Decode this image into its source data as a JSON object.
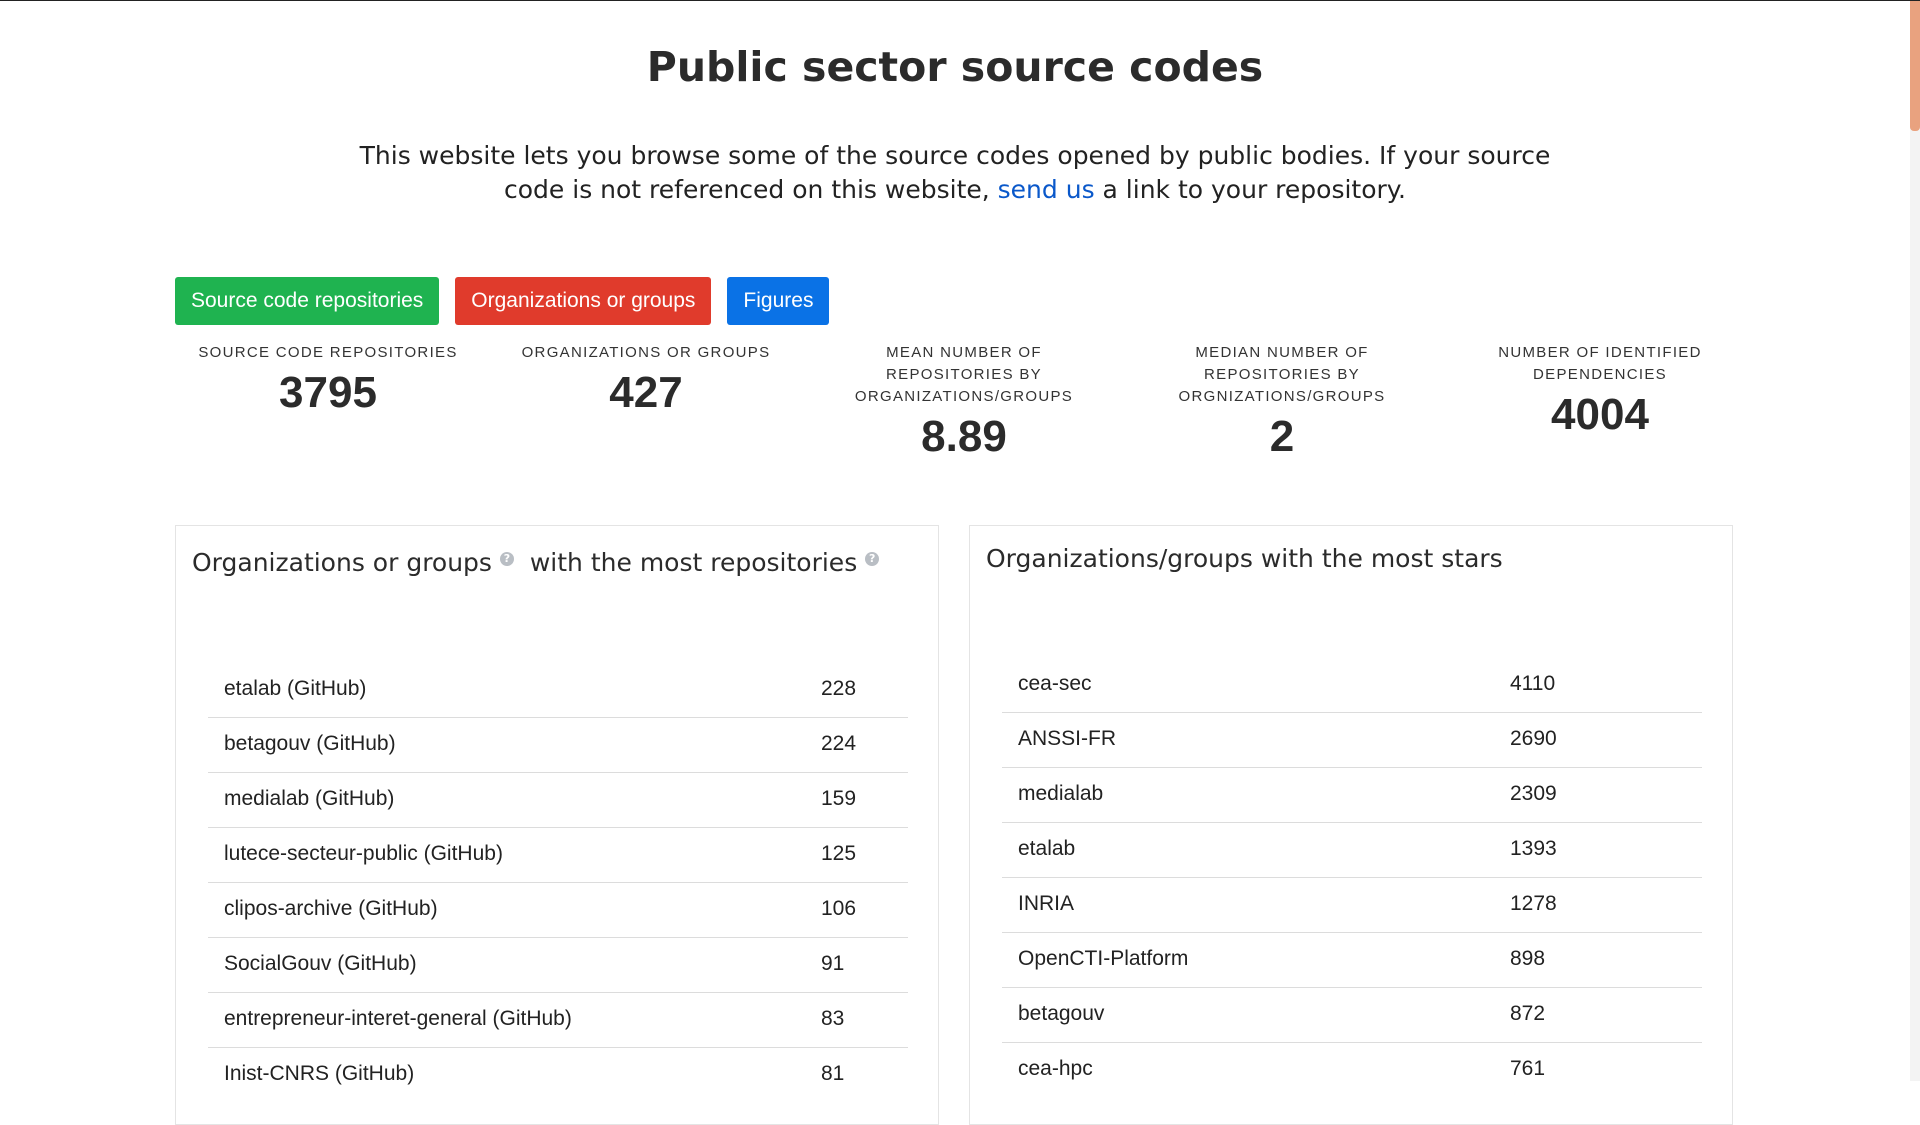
{
  "page": {
    "title": "Public sector source codes",
    "intro_before": "This website lets you browse some of the source codes opened by public bodies. If your source code is not referenced on this website, ",
    "intro_link": "send us",
    "intro_after": " a link to your repository."
  },
  "buttons": {
    "repos": "Source code repositories",
    "orgs": "Organizations or groups",
    "figures": "Figures"
  },
  "colors": {
    "green": "#1fb350",
    "red": "#e03b2c",
    "blue": "#0a72e6",
    "link": "#0a58ca"
  },
  "stats": [
    {
      "label": "SOURCE CODE REPOSITORIES",
      "value": "3795"
    },
    {
      "label": "ORGANIZATIONS OR GROUPS",
      "value": "427"
    },
    {
      "label": "MEAN NUMBER OF REPOSITORIES BY ORGANIZATIONS/GROUPS",
      "value": "8.89"
    },
    {
      "label": "MEDIAN NUMBER OF REPOSITORIES BY ORGNIZATIONS/GROUPS",
      "value": "2"
    },
    {
      "label": "NUMBER OF IDENTIFIED DEPENDENCIES",
      "value": "4004"
    }
  ],
  "panels": {
    "most_repos": {
      "title_part1": "Organizations or groups",
      "title_part2": "with the most repositories",
      "help_icon": "question-circle-icon",
      "rows": [
        {
          "name": "etalab (GitHub)",
          "count": "228"
        },
        {
          "name": "betagouv (GitHub)",
          "count": "224"
        },
        {
          "name": "medialab (GitHub)",
          "count": "159"
        },
        {
          "name": "lutece-secteur-public (GitHub)",
          "count": "125"
        },
        {
          "name": "clipos-archive (GitHub)",
          "count": "106"
        },
        {
          "name": "SocialGouv (GitHub)",
          "count": "91"
        },
        {
          "name": "entrepreneur-interet-general (GitHub)",
          "count": "83"
        },
        {
          "name": "Inist-CNRS (GitHub)",
          "count": "81"
        }
      ]
    },
    "most_stars": {
      "title": "Organizations/groups with the most stars",
      "rows": [
        {
          "name": "cea-sec",
          "count": "4110"
        },
        {
          "name": "ANSSI-FR",
          "count": "2690"
        },
        {
          "name": "medialab",
          "count": "2309"
        },
        {
          "name": "etalab",
          "count": "1393"
        },
        {
          "name": "INRIA",
          "count": "1278"
        },
        {
          "name": "OpenCTI-Platform",
          "count": "898"
        },
        {
          "name": "betagouv",
          "count": "872"
        },
        {
          "name": "cea-hpc",
          "count": "761"
        }
      ]
    }
  }
}
